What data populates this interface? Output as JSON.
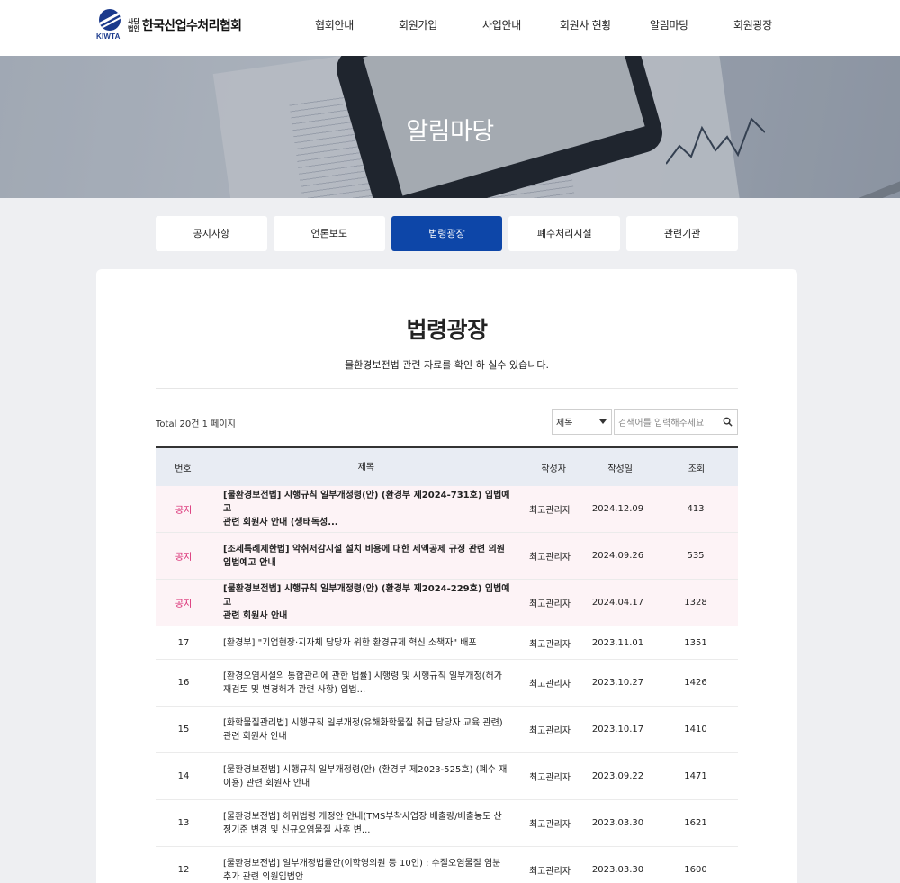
{
  "header": {
    "logo_abbr": "KIWTA",
    "logo_small_1": "사단",
    "logo_small_2": "법인",
    "logo_name": "한국산업수처리협회",
    "nav": [
      "협회안내",
      "회원가입",
      "사업안내",
      "회원사 현황",
      "알림마당",
      "회원광장"
    ]
  },
  "hero": {
    "title": "알림마당"
  },
  "tabs": [
    {
      "label": "공지사항",
      "active": false
    },
    {
      "label": "언론보도",
      "active": false
    },
    {
      "label": "법령광장",
      "active": true
    },
    {
      "label": "폐수처리시설",
      "active": false
    },
    {
      "label": "관련기관",
      "active": false
    }
  ],
  "page": {
    "title": "법령광장",
    "description": "물환경보전법 관련 자료를 확인 하 실수 있습니다."
  },
  "list": {
    "total_text": "Total 20건 1 페이지",
    "search": {
      "select_value": "제목",
      "placeholder": "검색어를 입력해주세요"
    },
    "columns": [
      "번호",
      "제목",
      "작성자",
      "작성일",
      "조회"
    ],
    "rows": [
      {
        "no": "공지",
        "notice": true,
        "title_1": "[물환경보전법] 시행규칙 일부개정령(안) (환경부 제2024-731호) 입법예고",
        "title_2": "관련 회원사 안내 (생태독성...",
        "author": "최고관리자",
        "date": "2024.12.09",
        "views": "413"
      },
      {
        "no": "공지",
        "notice": true,
        "title_1": "[조세특례제한법] 악취저감시설 설치 비용에 대한 세액공제 규정 관련 의원",
        "title_2": "입법예고 안내",
        "author": "최고관리자",
        "date": "2024.09.26",
        "views": "535"
      },
      {
        "no": "공지",
        "notice": true,
        "title_1": "[물환경보전법] 시행규칙 일부개정령(안) (환경부 제2024-229호) 입법예고",
        "title_2": "관련 회원사 안내",
        "author": "최고관리자",
        "date": "2024.04.17",
        "views": "1328"
      },
      {
        "no": "17",
        "notice": false,
        "title_1": "[환경부] \"기업현장·지자체 담당자 위한 환경규제 혁신 소책자\" 배포",
        "title_2": "",
        "author": "최고관리자",
        "date": "2023.11.01",
        "views": "1351"
      },
      {
        "no": "16",
        "notice": false,
        "title_1": "[환경오염시설의 통합관리에 관한 법률] 시행령 및 시행규칙 일부개정(허가",
        "title_2": "재검토 및 변경허가 관련 사항) 입법...",
        "author": "최고관리자",
        "date": "2023.10.27",
        "views": "1426"
      },
      {
        "no": "15",
        "notice": false,
        "title_1": "[화학물질관리법] 시행규칙 일부개정(유해화학물질 취급 담당자 교육 관련)",
        "title_2": "관련 회원사 안내",
        "author": "최고관리자",
        "date": "2023.10.17",
        "views": "1410"
      },
      {
        "no": "14",
        "notice": false,
        "title_1": "[물환경보전법] 시행규칙 일부개정령(안) (환경부 제2023-525호) (폐수 재",
        "title_2": "이용) 관련 회원사 안내",
        "author": "최고관리자",
        "date": "2023.09.22",
        "views": "1471"
      },
      {
        "no": "13",
        "notice": false,
        "title_1": "[물환경보전법] 하위법령 개정안 안내(TMS부착사업장 배출량/배출농도 산",
        "title_2": "정기준 변경 및 신규오염물질 사후 변...",
        "author": "최고관리자",
        "date": "2023.03.30",
        "views": "1621"
      },
      {
        "no": "12",
        "notice": false,
        "title_1": "[물환경보전법] 일부개정법률안(이학영의원 등 10인) : 수질오염물질 염분",
        "title_2": "추가 관련 의원입법안",
        "author": "최고관리자",
        "date": "2023.03.30",
        "views": "1600"
      }
    ]
  }
}
